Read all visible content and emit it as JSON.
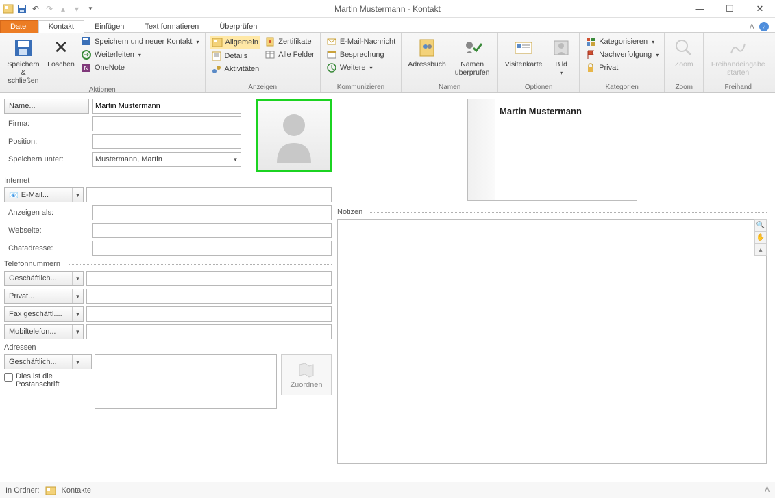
{
  "window": {
    "title": "Martin Mustermann  -  Kontakt"
  },
  "tabs": {
    "file": "Datei",
    "kontakt": "Kontakt",
    "einfuegen": "Einfügen",
    "textformatieren": "Text formatieren",
    "ueberpruefen": "Überprüfen"
  },
  "ribbon": {
    "aktionen": {
      "label": "Aktionen",
      "speichern_schliessen": "Speichern & schließen",
      "loeschen": "Löschen",
      "speichern_neuer": "Speichern und neuer Kontakt",
      "weiterleiten": "Weiterleiten",
      "onenote": "OneNote"
    },
    "anzeigen": {
      "label": "Anzeigen",
      "allgemein": "Allgemein",
      "details": "Details",
      "aktivitaeten": "Aktivitäten",
      "zertifikate": "Zertifikate",
      "alle_felder": "Alle Felder"
    },
    "kommunizieren": {
      "label": "Kommunizieren",
      "email": "E-Mail-Nachricht",
      "besprechung": "Besprechung",
      "weitere": "Weitere"
    },
    "namen": {
      "label": "Namen",
      "adressbuch": "Adressbuch",
      "namen_pruefen": "Namen überprüfen"
    },
    "optionen": {
      "label": "Optionen",
      "visitenkarte": "Visitenkarte",
      "bild": "Bild"
    },
    "kategorien_grp": {
      "label": "Kategorien",
      "kategorisieren": "Kategorisieren",
      "nachverfolgung": "Nachverfolgung",
      "privat": "Privat"
    },
    "zoom": {
      "label": "Zoom",
      "zoom": "Zoom"
    },
    "freihand": {
      "label": "Freihand",
      "start": "Freihandeingabe starten"
    }
  },
  "form": {
    "name_btn": "Name...",
    "name_value": "Martin Mustermann",
    "firma_label": "Firma:",
    "firma_value": "",
    "position_label": "Position:",
    "position_value": "",
    "speichern_unter_label": "Speichern unter:",
    "speichern_unter_value": "Mustermann, Martin",
    "internet_hdr": "Internet",
    "email_btn": "E-Mail...",
    "email_value": "",
    "anzeigen_als_label": "Anzeigen als:",
    "anzeigen_als_value": "",
    "webseite_label": "Webseite:",
    "webseite_value": "",
    "chat_label": "Chatadresse:",
    "chat_value": "",
    "telefon_hdr": "Telefonnummern",
    "tel1": "Geschäftlich...",
    "tel2": "Privat...",
    "tel3": "Fax geschäftl....",
    "tel4": "Mobiltelefon...",
    "adressen_hdr": "Adressen",
    "adr_btn": "Geschäftlich...",
    "postanschrift": "Dies ist die Postanschrift",
    "zuordnen": "Zuordnen"
  },
  "card": {
    "name": "Martin Mustermann"
  },
  "notes": {
    "hdr": "Notizen"
  },
  "status": {
    "in_ordner": "In Ordner:",
    "folder": "Kontakte"
  }
}
